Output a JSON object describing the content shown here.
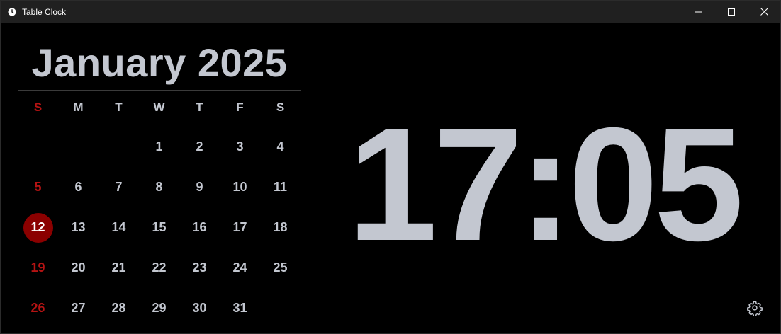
{
  "window": {
    "title": "Table Clock",
    "icon": "clock-icon",
    "controls": [
      "minimize-icon",
      "maximize-icon",
      "close-icon"
    ]
  },
  "calendar": {
    "month_title": "January 2025",
    "weekdays": [
      "S",
      "M",
      "T",
      "W",
      "T",
      "F",
      "S"
    ],
    "weeks": [
      [
        "",
        "",
        "",
        "1",
        "2",
        "3",
        "4"
      ],
      [
        "5",
        "6",
        "7",
        "8",
        "9",
        "10",
        "11"
      ],
      [
        "12",
        "13",
        "14",
        "15",
        "16",
        "17",
        "18"
      ],
      [
        "19",
        "20",
        "21",
        "22",
        "23",
        "24",
        "25"
      ],
      [
        "26",
        "27",
        "28",
        "29",
        "30",
        "31",
        ""
      ]
    ],
    "today": "12",
    "colors": {
      "text": "#c3c7d0",
      "sunday": "#b51313",
      "today_bg": "#8b0000"
    }
  },
  "clock": {
    "time": "17:05"
  },
  "settings": {
    "icon": "gear-icon"
  }
}
